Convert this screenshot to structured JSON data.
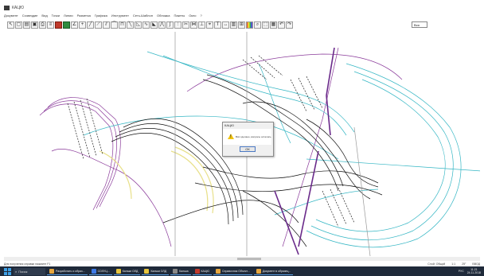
{
  "window": {
    "title": "КАЦЮ"
  },
  "menu": [
    "Документ",
    "Созвездие",
    "Вид",
    "Точки",
    "Линии",
    "Разметка",
    "Графика",
    "Инструмент",
    "Сеть-Шаблон",
    "Обложка",
    "Пакеты",
    "Окно",
    "?"
  ],
  "toolbar": {
    "icons": [
      "arrow-icon",
      "new-icon",
      "open-icon",
      "save-icon",
      "print-icon",
      "layers-icon",
      "flag-icon",
      "green-doc-icon",
      "angle-icon",
      "cross-icon",
      "line-tool-icon",
      "polyline-icon",
      "double-line-icon",
      "curve-icon",
      "rect-icon",
      "measure-icon",
      "triangle-icon",
      "wave-icon",
      "fill-icon",
      "zigzag-icon",
      "bezier-icon",
      "offset-icon",
      "trim-icon",
      "join-icon",
      "split-icon",
      "snap-icon",
      "text-icon",
      "dimension-icon",
      "hatch-icon",
      "grid-icon",
      "rainbow-palette-icon",
      "zoom-icon",
      "select-icon",
      "properties-icon",
      "undo-icon",
      "redo-icon"
    ],
    "zoom_value": "Вся"
  },
  "dialog": {
    "title": "КАЦЮ",
    "message": "Всё сделано, вопросы остались",
    "ok_label": "ОК"
  },
  "statusbar": {
    "left": "Для получения справки нажмите F1",
    "cells": [
      "Слой: Общий",
      "1:1",
      "25°",
      "ВВОД"
    ]
  },
  "taskbar": {
    "search_text": "Поиск",
    "tasks": [
      "Разработать и образ...",
      "СОЛУЦ...",
      "Кальки ОЛД",
      "Кальки ОЛД",
      "Калька",
      "КАЦЮ",
      "Справочник Объект...",
      "Документ в образец..."
    ],
    "time": "11:21",
    "date": "24.11.2018",
    "lang": "РУС"
  },
  "colors": {
    "taskbar": "#1f2a3a",
    "cyan": "#34b6c4",
    "magenta": "#8a3a9a",
    "yellow": "#e8e08a",
    "black": "#111111"
  }
}
